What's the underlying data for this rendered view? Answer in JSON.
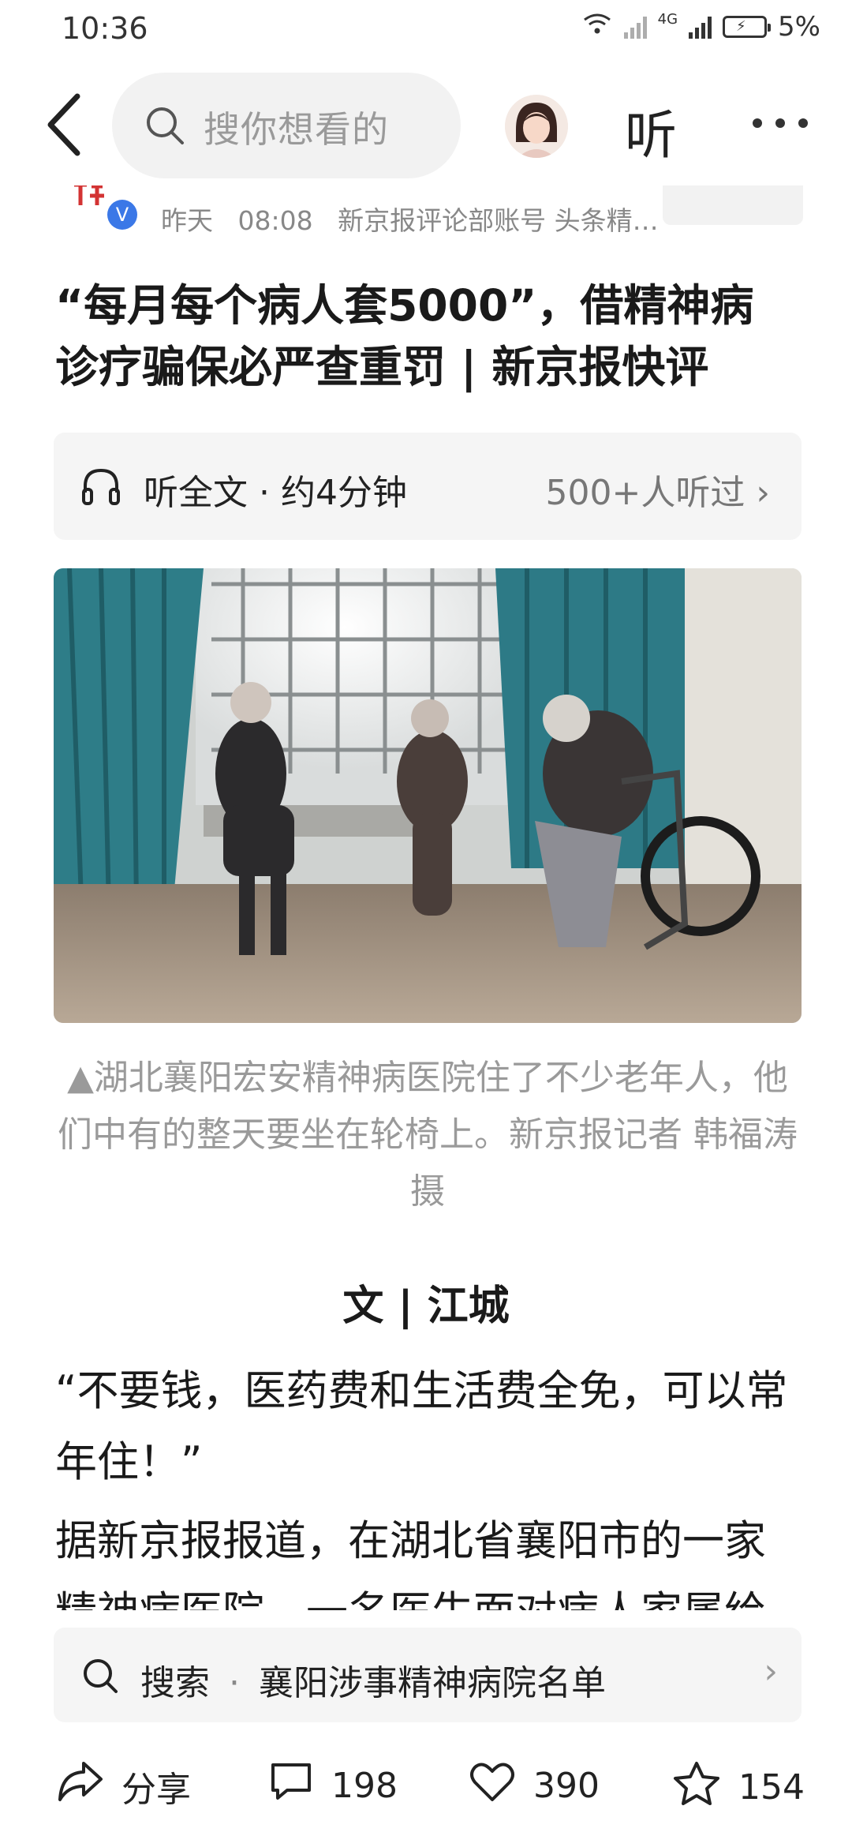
{
  "status_bar": {
    "time": "10:36",
    "network": "4G",
    "battery": "5%"
  },
  "nav": {
    "search_placeholder": "搜你想看的",
    "listen_label": "听"
  },
  "author": {
    "date_label": "昨天",
    "time": "08:08",
    "account": "新京报评论部账号 头条精…"
  },
  "article": {
    "title": "“每月每个病人套5000”，借精神病诊疗骗保必严查重罚 | 新京报快评",
    "listen_full": "听全文 · 约4分钟",
    "listen_count": "500+人听过",
    "photo_caption": "▲湖北襄阳宏安精神病医院住了不少老年人，他们中有的整天要坐在轮椅上。新京报记者 韩福涛 摄",
    "byline": "文 | 江城",
    "paragraph1": "“不要钱，医药费和生活费全免，可以常年住！”",
    "paragraph2": "据新京报报道，在湖北省襄阳市的一家精神病医院，一名医生面对病人家属给"
  },
  "search_suggestion": {
    "prefix": "搜索",
    "separator": "·",
    "query": "襄阳涉事精神病院名单"
  },
  "toolbar": {
    "share_label": "分享",
    "comment_count": "198",
    "like_count": "390",
    "favorite_count": "154"
  },
  "icons": [
    "back-icon",
    "search-icon",
    "headphones-icon",
    "chevron-right-icon",
    "share-icon",
    "comment-icon",
    "like-icon",
    "favorite-icon",
    "more-icon"
  ],
  "colors": {
    "verified_badge": "#3b78e7",
    "logo_red": "#d33333"
  }
}
